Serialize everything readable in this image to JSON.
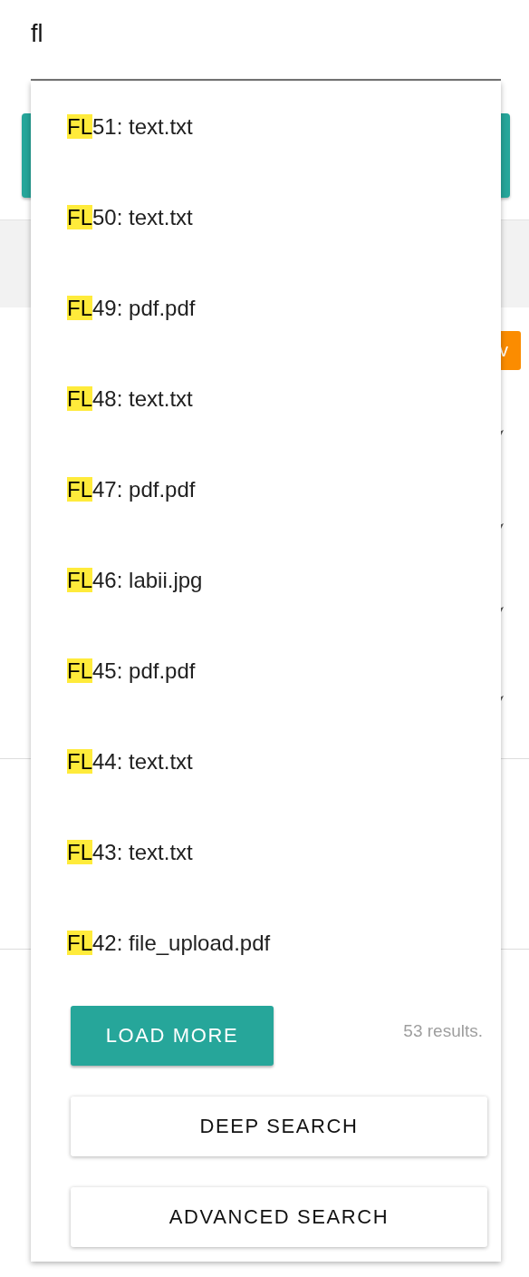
{
  "search": {
    "value": "fl"
  },
  "behind": {
    "badge": "v"
  },
  "results": [
    {
      "match": "FL",
      "rest": "51: text.txt"
    },
    {
      "match": "FL",
      "rest": "50: text.txt"
    },
    {
      "match": "FL",
      "rest": "49: pdf.pdf"
    },
    {
      "match": "FL",
      "rest": "48: text.txt"
    },
    {
      "match": "FL",
      "rest": "47: pdf.pdf"
    },
    {
      "match": "FL",
      "rest": "46: labii.jpg"
    },
    {
      "match": "FL",
      "rest": "45: pdf.pdf"
    },
    {
      "match": "FL",
      "rest": "44: text.txt"
    },
    {
      "match": "FL",
      "rest": "43: text.txt"
    },
    {
      "match": "FL",
      "rest": "42: file_upload.pdf"
    }
  ],
  "load_more": "LOAD MORE",
  "count": "53 results.",
  "buttons": [
    "DEEP SEARCH",
    "ADVANCED SEARCH"
  ]
}
